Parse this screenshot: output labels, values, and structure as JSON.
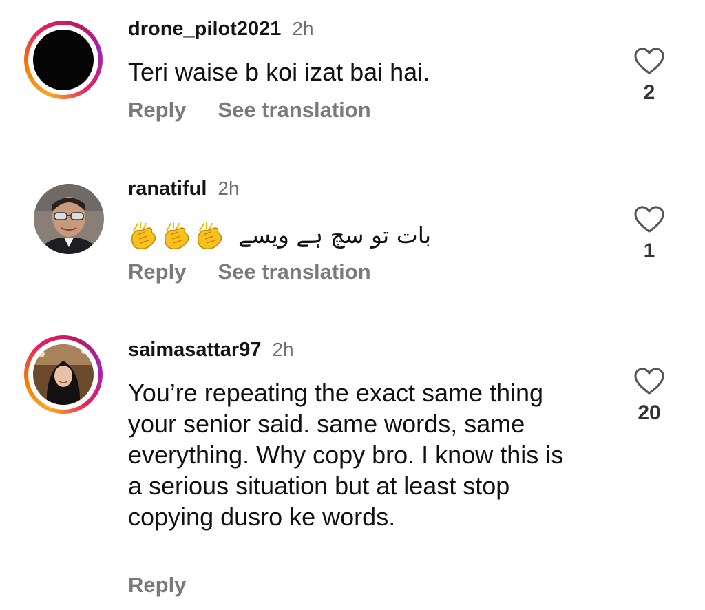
{
  "comments": [
    {
      "username": "drone_pilot2021",
      "time": "2h",
      "text": "Teri waise b koi izat bai hai.",
      "reply_label": "Reply",
      "translate_label": "See translation",
      "likes": "2",
      "avatar": "black-circle",
      "story_ring": true
    },
    {
      "username": "ranatiful",
      "time": "2h",
      "text": "بات تو سچ ہے ویسے",
      "emoji": [
        "clapping-hands",
        "clapping-hands",
        "clapping-hands"
      ],
      "reply_label": "Reply",
      "translate_label": "See translation",
      "likes": "1",
      "avatar": "man-with-sunglasses",
      "story_ring": false
    },
    {
      "username": "saimasattar97",
      "time": "2h",
      "text": "You’re repeating the exact same thing your senior said. same words, same everything. Why copy bro. I know this is a serious situation but at least stop copying dusro ke words.",
      "reply_label": "Reply",
      "likes": "20",
      "avatar": "woman-portrait",
      "story_ring": true
    }
  ],
  "icons": {
    "like": "heart-outline-icon",
    "emoji": "clapping-hands-icon"
  },
  "colors": {
    "text": "#111111",
    "muted": "#7a7a7a",
    "ring_gradient": [
      "#f9a825",
      "#e91e63",
      "#9c27b0"
    ]
  }
}
